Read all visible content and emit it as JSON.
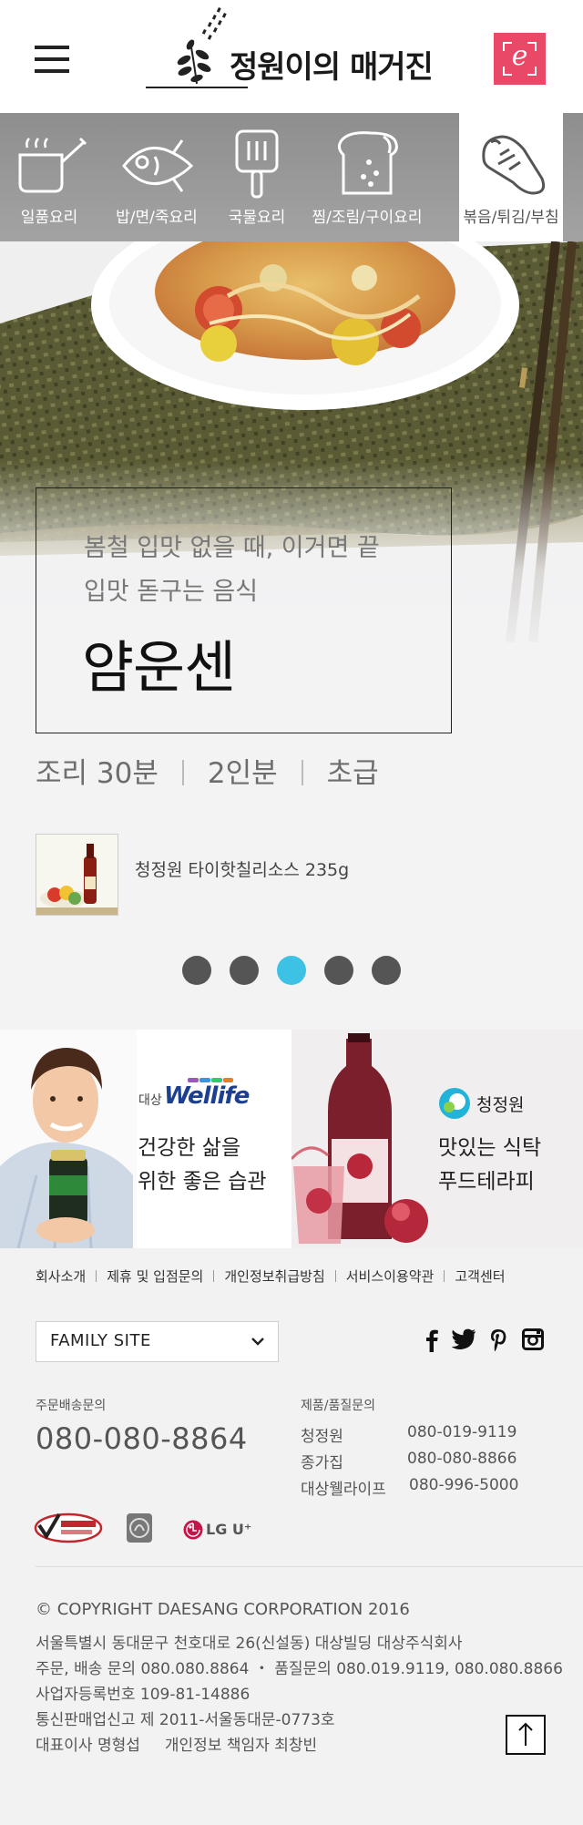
{
  "header": {
    "logo_text": "정원이의 매거진",
    "e_button_label": "e"
  },
  "categories": [
    {
      "label": "일품요리",
      "icon": "pot-icon",
      "active": false
    },
    {
      "label": "밥/면/죽요리",
      "icon": "fish-icon",
      "active": false
    },
    {
      "label": "국물요리",
      "icon": "spatula-icon",
      "active": false
    },
    {
      "label": "찜/조림/구이요리",
      "icon": "bread-icon",
      "active": false
    },
    {
      "label": "볶음/튀김/부침",
      "icon": "eggplant-icon",
      "active": true
    }
  ],
  "hero": {
    "subtitle_line1": "봄철 입맛 없을 때, 이거면 끝",
    "subtitle_line2": "입맛 돋구는 음식",
    "title": "얌운센",
    "meta": [
      "조리 30분",
      "2인분",
      "초급"
    ],
    "product_name": "청정원 타이핫칠리소스 235g",
    "slides_total": 5,
    "active_slide": 3
  },
  "banners": {
    "left": {
      "brand_small": "대상",
      "brand": "Wellife",
      "line1": "건강한 삶을",
      "line2": "위한 좋은 습관"
    },
    "right": {
      "brand": "청정원",
      "line1": "맛있는 식탁",
      "line2": "푸드테라피"
    }
  },
  "footer": {
    "links": [
      "회사소개",
      "제휴 및 입점문의",
      "개인정보취급방침",
      "서비스이용약관",
      "고객센터"
    ],
    "family_site": "FAMILY SITE",
    "social": [
      "facebook-icon",
      "twitter-icon",
      "pinterest-icon",
      "instagram-icon"
    ],
    "order_label": "주문배송문의",
    "order_phone": "080-080-8864",
    "quality_label": "제품/품질문의",
    "contacts": [
      {
        "name": "청정원",
        "phone": "080-019-9119"
      },
      {
        "name": "종가집",
        "phone": "080-080-8866"
      },
      {
        "name": "대상웰라이프",
        "phone": "080-996-5000"
      }
    ],
    "cert_lg": "LG U⁺",
    "copyright": "© COPYRIGHT DAESANG CORPORATION 2016",
    "info_lines": [
      "서울특별시 동대문구 천호대로 26(신설동) 대상빌딩 대상주식회사",
      "주문, 배송 문의 080.080.8864 ・ 품질문의 080.019.9119, 080.080.8866",
      "사업자등록번호 109-81-14886",
      "통신판매업신고 제 2011-서울동대문-0773호",
      "대표이사 명형섭     개인정보 책임자 최창빈"
    ]
  },
  "colors": {
    "accent_pink": "#e94866",
    "dot_active": "#3dc2e6",
    "dot_inactive": "#555555"
  }
}
